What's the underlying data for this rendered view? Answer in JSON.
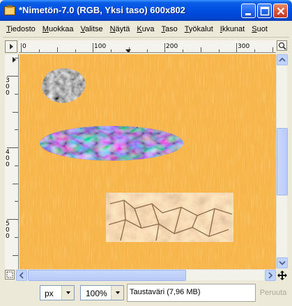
{
  "window": {
    "title": "*Nimetön-7.0 (RGB, Yksi taso) 600x802"
  },
  "menu": [
    {
      "u": "T",
      "rest": "iedosto"
    },
    {
      "u": "M",
      "rest": "uokkaa"
    },
    {
      "u": "V",
      "rest": "alitse"
    },
    {
      "u": "N",
      "rest": "äytä"
    },
    {
      "u": "K",
      "rest": "uva"
    },
    {
      "u": "T",
      "rest": "aso"
    },
    {
      "u": "T",
      "rest": "yökalut"
    },
    {
      "u": "I",
      "rest": "kkunat"
    },
    {
      "u": "S",
      "rest": "uot"
    }
  ],
  "rulers": {
    "horizontal_labels": [
      "0",
      "100",
      "200",
      "300"
    ],
    "vertical_labels": [
      "300",
      "400",
      "500"
    ]
  },
  "status": {
    "unit": "px",
    "zoom": "100%",
    "message": "Taustaväri (7,96 MB)",
    "cancel_label": "Peruuta"
  },
  "colors": {
    "canvas_bg": "#f7b54a",
    "titlebar": "#0050e0"
  }
}
